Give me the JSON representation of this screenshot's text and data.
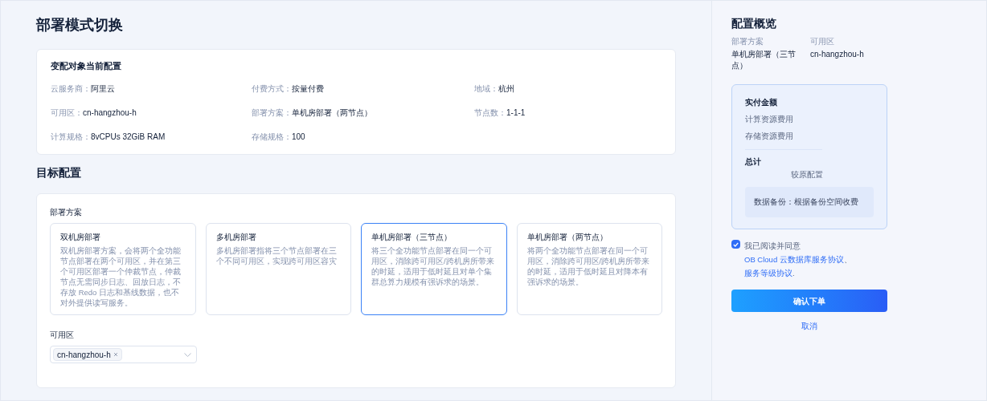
{
  "page_title": "部署模式切换",
  "current_config": {
    "title": "变配对象当前配置",
    "fields": [
      {
        "label": "云服务商：",
        "value": "阿里云"
      },
      {
        "label": "付费方式：",
        "value": "按量付费"
      },
      {
        "label": "地域：",
        "value": "杭州"
      },
      {
        "label": "可用区：",
        "value": "cn-hangzhou-h"
      },
      {
        "label": "部署方案：",
        "value": "单机房部署（两节点）"
      },
      {
        "label": "节点数：",
        "value": "1-1-1"
      },
      {
        "label": "计算规格：",
        "value": "8vCPUs 32GiB RAM"
      },
      {
        "label": "存储规格：",
        "value": "100"
      }
    ]
  },
  "target": {
    "title": "目标配置",
    "plan_label": "部署方案",
    "plans": [
      {
        "name": "双机房部署",
        "description": "双机房部署方案，会将两个全功能节点部署在两个可用区，并在第三个可用区部署一个仲裁节点，仲裁节点无需同步日志、回放日志，不存放 Redo 日志和基线数据，也不对外提供读写服务。",
        "selected": false
      },
      {
        "name": "多机房部署",
        "description": "多机房部署指将三个节点部署在三个不同可用区，实现跨可用区容灾",
        "selected": false
      },
      {
        "name": "单机房部署（三节点）",
        "description": "将三个全功能节点部署在同一个可用区，消除跨可用区/跨机房所带来的时延，适用于低时延且对单个集群总算力规模有强诉求的场景。",
        "selected": true
      },
      {
        "name": "单机房部署（两节点）",
        "description": "将两个全功能节点部署在同一个可用区，消除跨可用区/跨机房所带来的时延，适用于低时延且对降本有强诉求的场景。",
        "selected": false
      }
    ],
    "zone_label": "可用区",
    "zone_tags": [
      "cn-hangzhou-h"
    ]
  },
  "summary": {
    "title": "配置概览",
    "items": [
      {
        "label": "部署方案",
        "value": "单机房部署（三节点）"
      },
      {
        "label": "可用区",
        "value": "cn-hangzhou-h"
      }
    ],
    "cost_title": "实付金额",
    "cost_items": [
      "计算资源费用",
      "存储资源费用"
    ],
    "total_label": "总计",
    "compare_label": "较原配置",
    "backup_note": "数据备份：根据备份空间收费"
  },
  "agreement": {
    "checked": true,
    "prefix": "我已阅读并同意 ",
    "links": [
      "OB Cloud 云数据库服务协议",
      "服务等级协议"
    ],
    "separator": "、",
    "suffix": "."
  },
  "confirm_button": "确认下单",
  "cancel_link": "取消"
}
